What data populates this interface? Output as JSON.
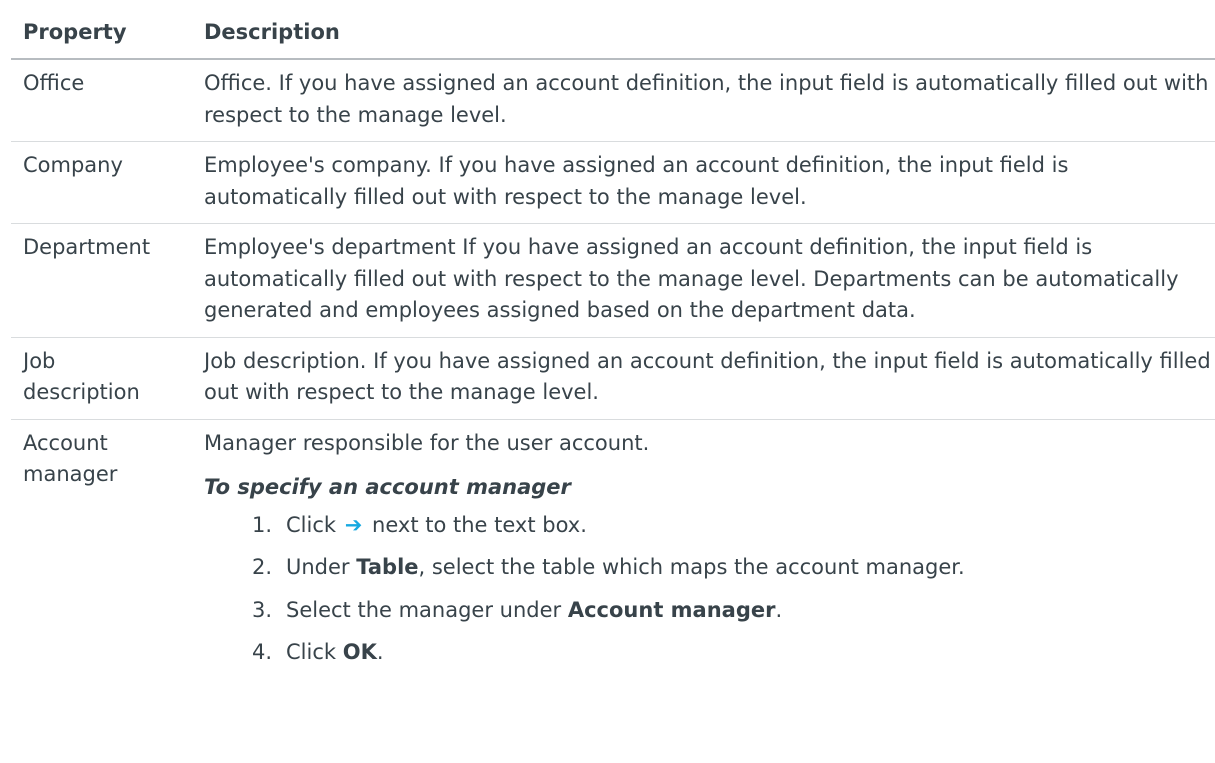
{
  "table": {
    "headers": {
      "property": "Property",
      "description": "Description"
    },
    "rows": [
      {
        "property": "Office",
        "description": "Office. If you have assigned an account definition, the input field is automatically filled out with respect to the manage level."
      },
      {
        "property": "Company",
        "description": "Employee's company. If you have assigned an account definition, the input field is automatically filled out with respect to the manage level."
      },
      {
        "property": "Department",
        "description": "Employee's department If you have assigned an account definition, the input field is automatically filled out with respect to the manage level. Departments can be automatically generated and employees assigned based on the department data."
      },
      {
        "property_line1": "Job",
        "property_line2": "description",
        "description": "Job description. If you have assigned an account definition, the input field is automatically filled out with respect to the manage level."
      },
      {
        "property_line1": "Account",
        "property_line2": "manager",
        "description": "Manager responsible for the user account.",
        "procedure_title": "To specify an account manager",
        "steps": [
          {
            "num": "1.",
            "pre": "Click",
            "icon": "arrow-right-icon",
            "icon_glyph": "➔",
            "post": "next to the text box."
          },
          {
            "num": "2.",
            "pre": "Under ",
            "bold": "Table",
            "post": ", select the table which maps the account manager."
          },
          {
            "num": "3.",
            "pre": "Select the manager under ",
            "bold": "Account manager",
            "post": "."
          },
          {
            "num": "4.",
            "pre": "Click ",
            "bold": "OK",
            "post": "."
          }
        ]
      }
    ]
  },
  "colors": {
    "text": "#38434a",
    "accent_arrow": "#17a9e1",
    "header_rule": "#b7bcc0",
    "row_rule": "#d9dcde"
  }
}
